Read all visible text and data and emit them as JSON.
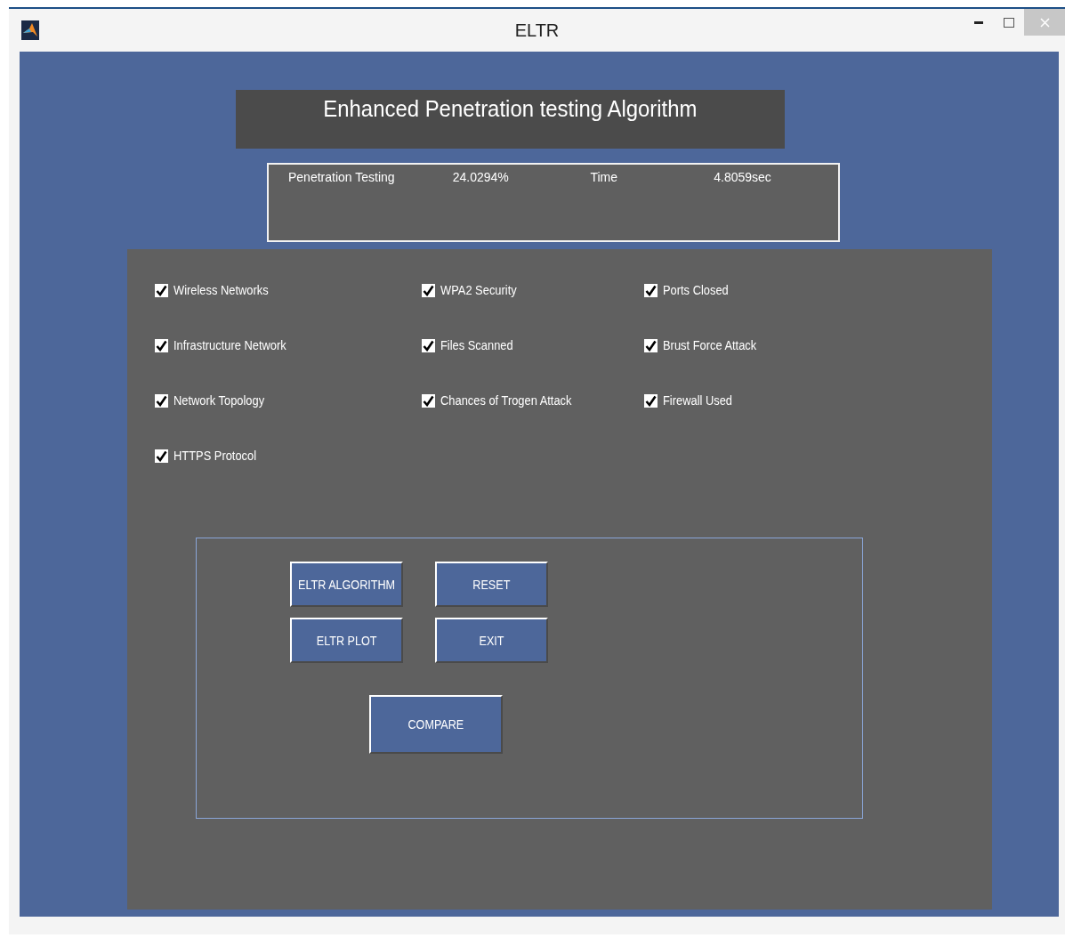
{
  "window": {
    "title": "ELTR"
  },
  "banner": {
    "title": "Enhanced Penetration testing Algorithm"
  },
  "results": [
    {
      "label": "Penetration Testing",
      "value": "24.0294%"
    },
    {
      "label": "Time",
      "value": "4.8059sec"
    }
  ],
  "options": [
    {
      "label": "Wireless Networks",
      "checked": true
    },
    {
      "label": "WPA2 Security",
      "checked": true
    },
    {
      "label": "Ports Closed",
      "checked": true
    },
    {
      "label": "Infrastructure Network",
      "checked": true
    },
    {
      "label": "Files Scanned",
      "checked": true
    },
    {
      "label": "Brust Force Attack",
      "checked": true
    },
    {
      "label": "Network Topology",
      "checked": true
    },
    {
      "label": "Chances of Trogen Attack",
      "checked": true
    },
    {
      "label": "Firewall Used",
      "checked": true
    },
    {
      "label": "HTTPS Protocol",
      "checked": true
    }
  ],
  "buttons": [
    "ELTR ALGORITHM",
    "RESET",
    "ELTR PLOT",
    "EXIT",
    "COMPARE"
  ]
}
